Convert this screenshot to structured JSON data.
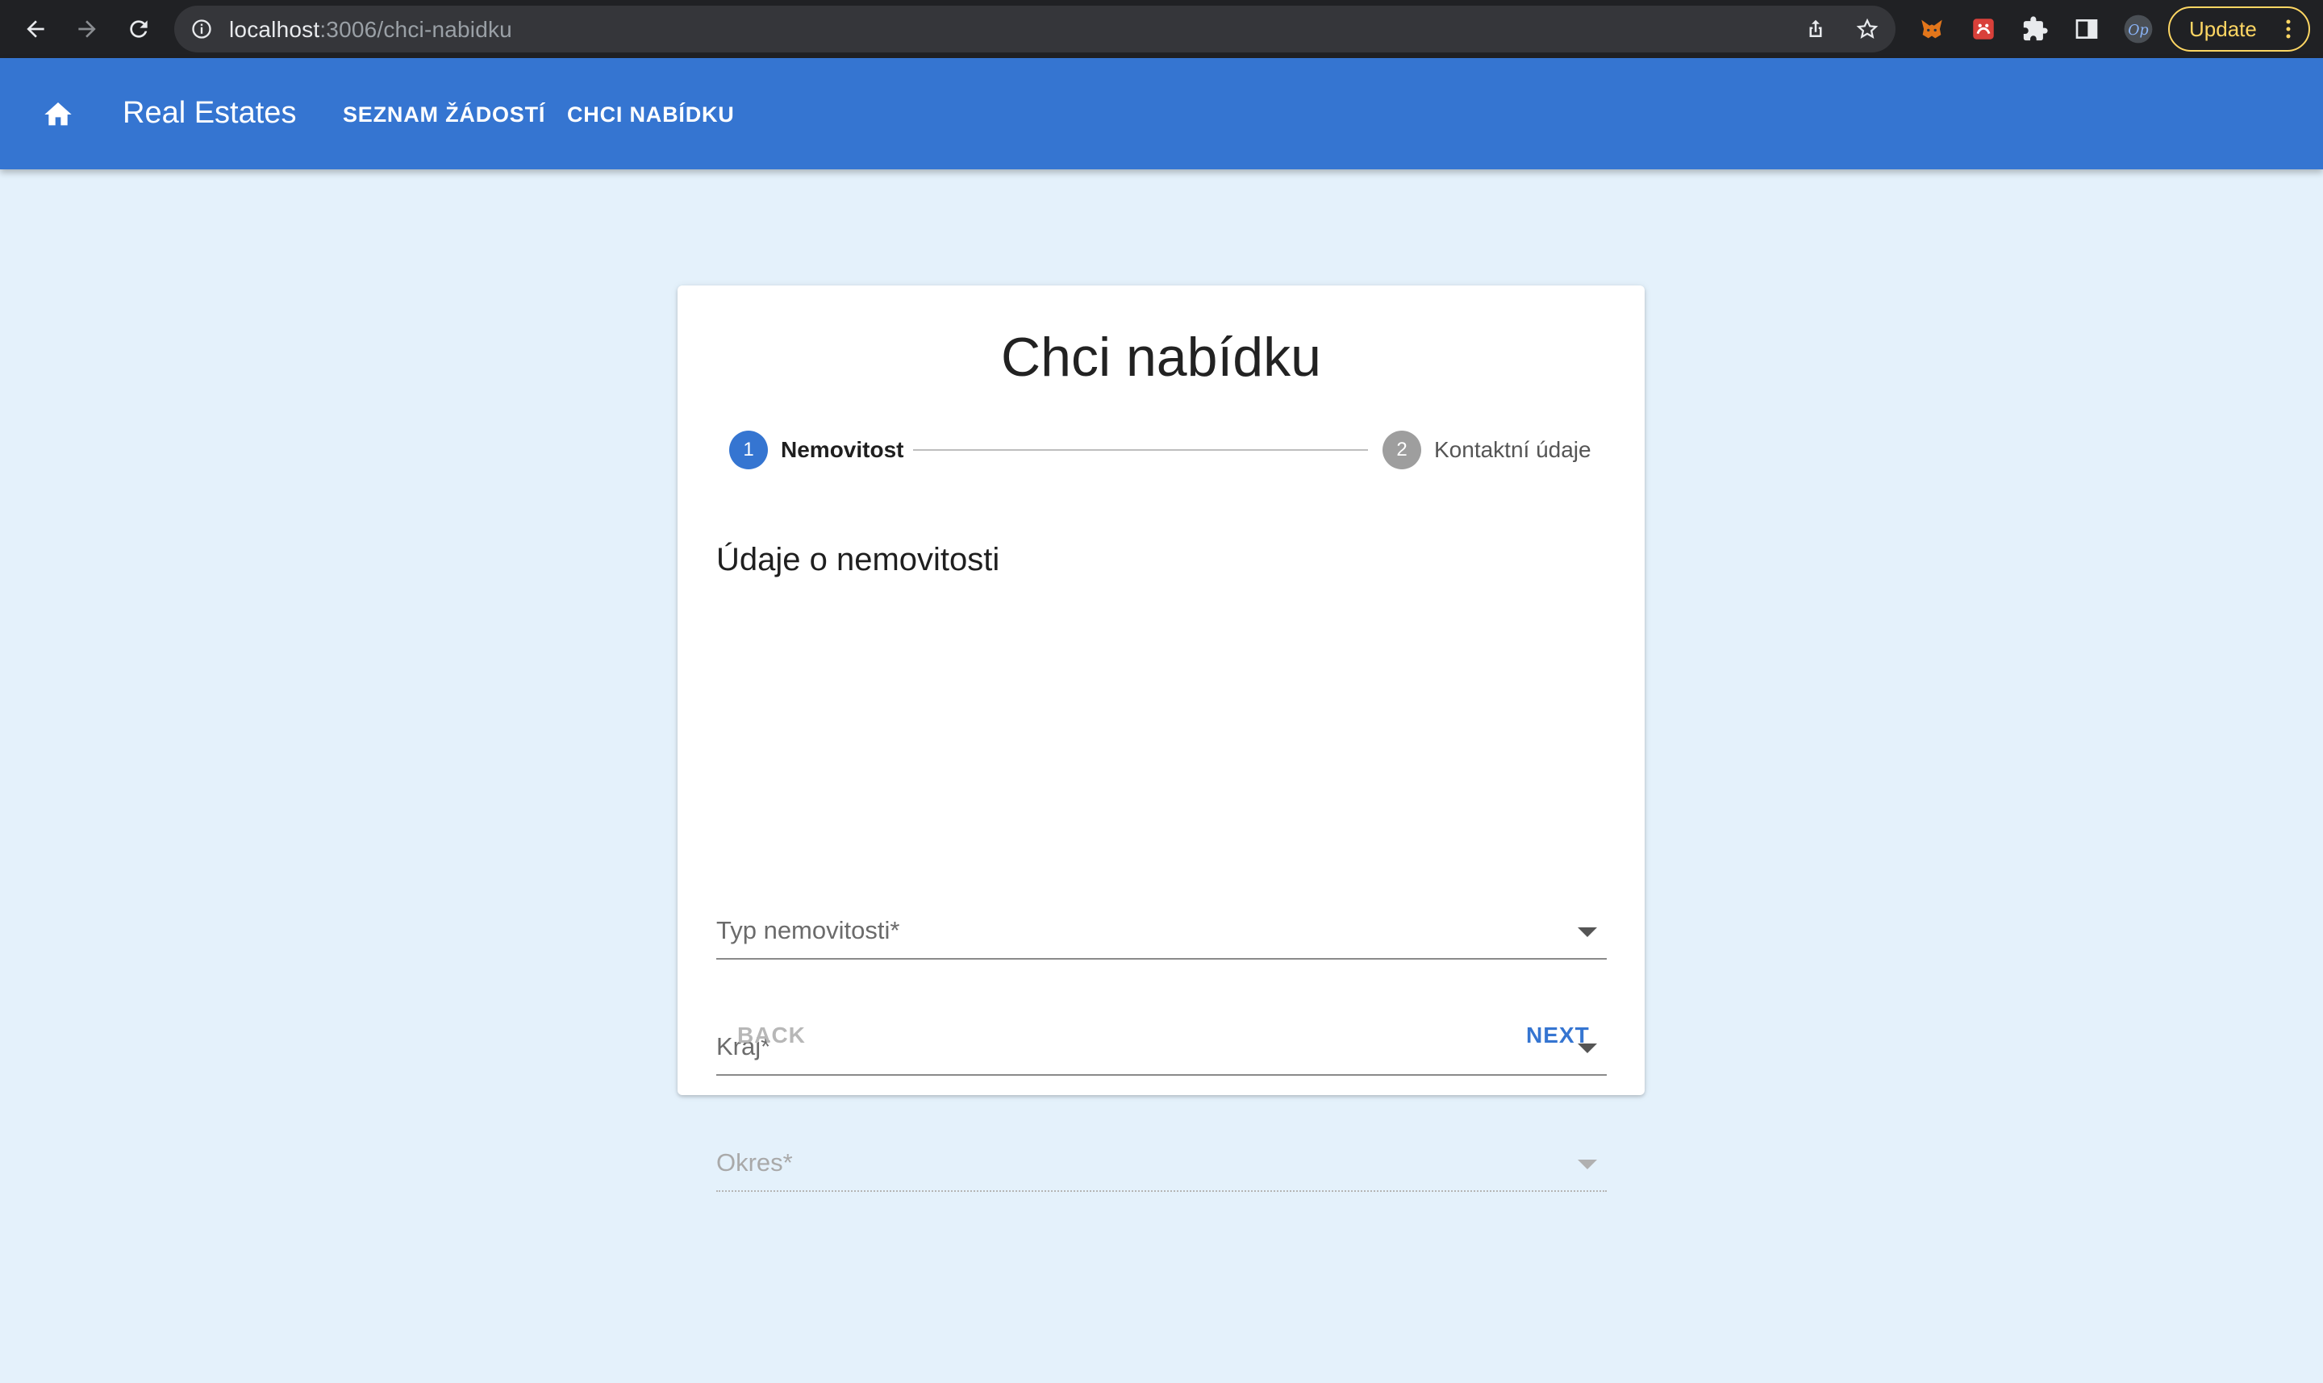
{
  "browser": {
    "url_host": "localhost",
    "url_path": ":3006/chci-nabidku",
    "update_label": "Update"
  },
  "appbar": {
    "brand": "Real Estates",
    "nav": [
      "SEZNAM ŽÁDOSTÍ",
      "CHCI NABÍDKU"
    ]
  },
  "form": {
    "title": "Chci nabídku",
    "steps": [
      {
        "number": "1",
        "label": "Nemovitost",
        "active": true
      },
      {
        "number": "2",
        "label": "Kontaktní údaje",
        "active": false
      }
    ],
    "section_heading": "Údaje o nemovitosti",
    "fields": [
      {
        "label": "Typ nemovitosti*",
        "disabled": false
      },
      {
        "label": "Kraj*",
        "disabled": false
      },
      {
        "label": "Okres*",
        "disabled": true
      }
    ],
    "back_label": "BACK",
    "next_label": "NEXT"
  },
  "colors": {
    "primary": "#3575d1",
    "page_background": "#e4f1fb",
    "chrome_background": "#202124",
    "step_inactive": "#9e9e9e"
  }
}
